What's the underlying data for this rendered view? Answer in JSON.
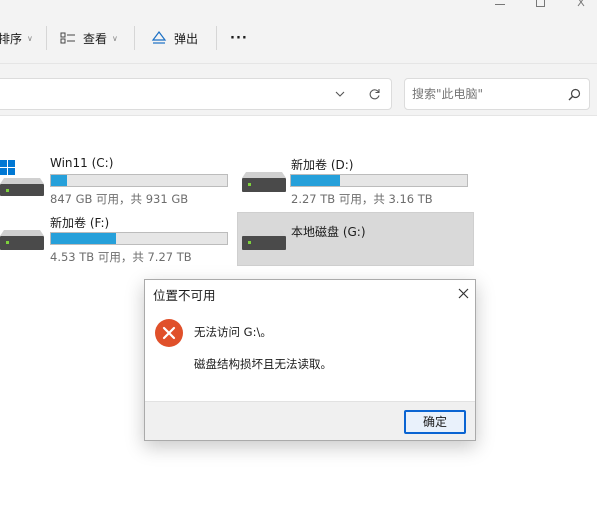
{
  "toolbar": {
    "sort_label": "排序",
    "view_label": "查看",
    "eject_label": "弹出",
    "more_label": "···"
  },
  "search": {
    "placeholder": "搜索\"此电脑\""
  },
  "drives": [
    {
      "name": "Win11 (C:)",
      "space": "847 GB 可用，共 931 GB",
      "used_fraction": 0.09,
      "os_drive": true
    },
    {
      "name": "新加卷 (D:)",
      "space": "2.27 TB 可用，共 3.16 TB",
      "used_fraction": 0.28
    },
    {
      "name": "新加卷 (F:)",
      "space": "4.53 TB 可用，共 7.27 TB",
      "used_fraction": 0.37
    },
    {
      "name": "本地磁盘 (G:)",
      "selected": true
    }
  ],
  "dialog": {
    "title": "位置不可用",
    "message_line1": "无法访问 G:\\。",
    "message_line2": "磁盘结构损坏且无法读取。",
    "ok_label": "确定"
  },
  "colors": {
    "accent": "#26a0da",
    "error_icon": "#e0502a",
    "focus_border": "#0a64d2",
    "windows_logo": "#0078d4"
  }
}
